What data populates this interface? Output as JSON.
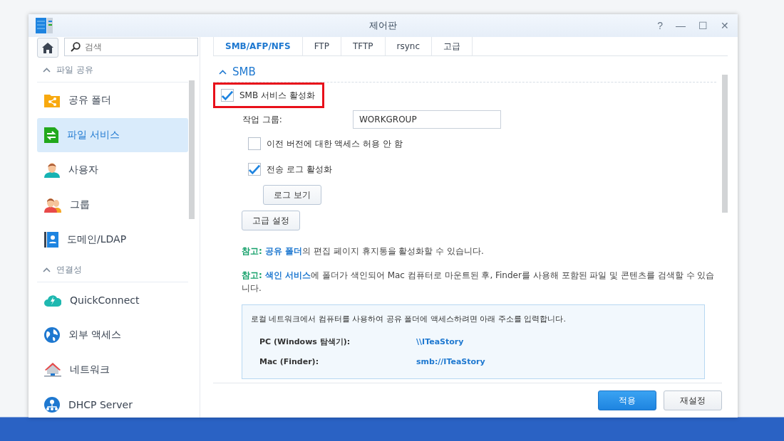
{
  "window": {
    "title": "제어판",
    "controls": [
      "?",
      "—",
      "☐",
      "✕"
    ]
  },
  "sidebar": {
    "search": {
      "placeholder": "검색"
    },
    "sections": [
      {
        "title": "파일 공유",
        "expanded": true,
        "items": [
          {
            "label": "공유 폴더",
            "selected": false
          },
          {
            "label": "파일 서비스",
            "selected": true
          },
          {
            "label": "사용자",
            "selected": false
          },
          {
            "label": "그룹",
            "selected": false
          },
          {
            "label": "도메인/LDAP",
            "selected": false
          }
        ]
      },
      {
        "title": "연결성",
        "expanded": true,
        "items": [
          {
            "label": "QuickConnect",
            "selected": false
          },
          {
            "label": "외부 액세스",
            "selected": false
          },
          {
            "label": "네트워크",
            "selected": false
          },
          {
            "label": "DHCP Server",
            "selected": false
          }
        ]
      }
    ]
  },
  "tabs": [
    {
      "label": "SMB/AFP/NFS",
      "selected": true
    },
    {
      "label": "FTP",
      "selected": false
    },
    {
      "label": "TFTP",
      "selected": false
    },
    {
      "label": "rsync",
      "selected": false
    },
    {
      "label": "고급",
      "selected": false
    }
  ],
  "section": {
    "title": "SMB",
    "expanded": true
  },
  "rows": [
    {
      "kind": "checkbox",
      "label": "SMB 서비스 활성화",
      "checked": true,
      "highlighted": true,
      "indent": false
    },
    {
      "kind": "field",
      "label": "작업 그룹:",
      "value": "WORKGROUP"
    },
    {
      "kind": "checkbox",
      "label": "이전 버전에 대한 액세스 허용 안 함",
      "checked": false,
      "highlighted": false,
      "indent": true
    },
    {
      "kind": "checkbox",
      "label": "전송 로그 활성화",
      "checked": true,
      "highlighted": false,
      "indent": true
    },
    {
      "kind": "button",
      "label": "로그 보기",
      "indent": true
    },
    {
      "kind": "button",
      "label": "고급 설정",
      "indent": false
    }
  ],
  "notes": [
    [
      {
        "kind": "label",
        "text": "참고:"
      },
      {
        "kind": "link",
        "text": "공유 폴더"
      },
      {
        "kind": "plain",
        "text": "의 편집 페이지 휴지통을 활성화할 수 있습니다."
      }
    ],
    [
      {
        "kind": "label",
        "text": "참고:"
      },
      {
        "kind": "link",
        "text": "색인 서비스"
      },
      {
        "kind": "plain",
        "text": "에 폴더가 색인되어 Mac 컴퓨터로 마운트된 후, Finder를 사용해 포함된 파일 및 콘텐츠를 검색할 수 있습니다."
      }
    ]
  ],
  "info": {
    "text": "로컬 네트워크에서 컴퓨터를 사용하여 공유 폴더에 액세스하려면 아래 주소를 입력합니다.",
    "entries": [
      {
        "label": "PC (Windows 탐색기):",
        "value": "\\\\ITeaStory"
      },
      {
        "label": "Mac (Finder):",
        "value": "smb://ITeaStory"
      }
    ]
  },
  "footer": {
    "buttons": [
      {
        "label": "적용",
        "primary": true
      },
      {
        "label": "재설정",
        "primary": false
      }
    ]
  }
}
